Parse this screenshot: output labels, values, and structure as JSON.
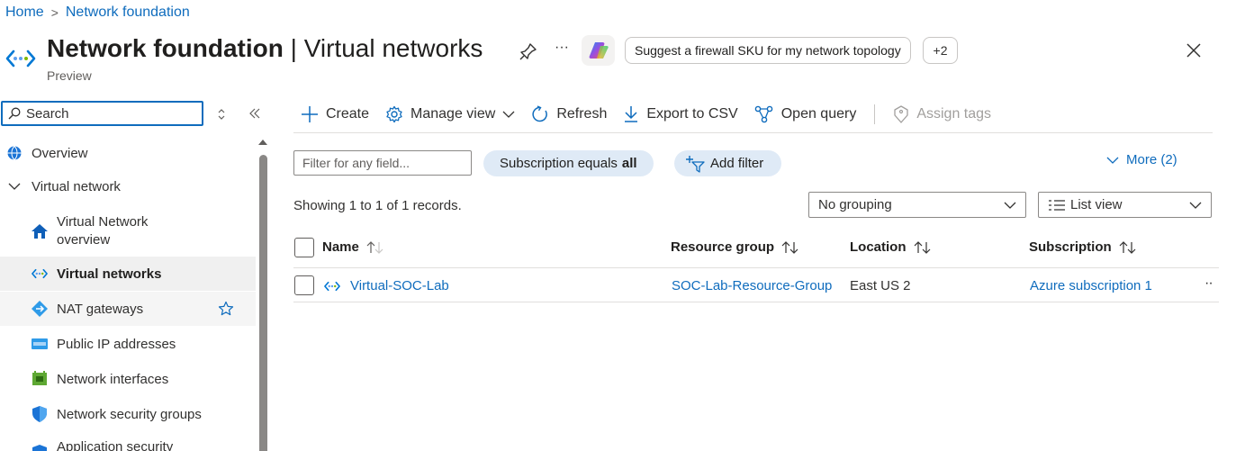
{
  "breadcrumb": {
    "home": "Home",
    "separator": ">",
    "current": "Network foundation"
  },
  "header": {
    "title_bold": "Network foundation",
    "title_separator": "|",
    "title_rest": "Virtual networks",
    "subtitle": "Preview",
    "more": "···",
    "suggestion": "Suggest a firewall SKU for my network topology",
    "more_suggestions": "+2",
    "icons": [
      "virtual-network-icon",
      "pin-icon",
      "more-icon",
      "copilot-icon",
      "close-icon"
    ]
  },
  "sidebar": {
    "search_placeholder": "Search",
    "items": [
      {
        "label": "Overview",
        "icon": "globe-icon",
        "level": 0
      },
      {
        "label": "Virtual network",
        "icon": "chevron-down-icon",
        "level": 0
      },
      {
        "label": "Virtual Network overview",
        "icon": "home-icon",
        "level": 1
      },
      {
        "label": "Virtual networks",
        "icon": "virtual-network-icon",
        "level": 1,
        "selected": true
      },
      {
        "label": "NAT gateways",
        "icon": "nat-gateway-icon",
        "level": 1,
        "starred": true
      },
      {
        "label": "Public IP addresses",
        "icon": "public-ip-icon",
        "level": 1
      },
      {
        "label": "Network interfaces",
        "icon": "network-interface-icon",
        "level": 1
      },
      {
        "label": "Network security groups",
        "icon": "shield-icon",
        "level": 1
      },
      {
        "label": "Application security",
        "icon": "asg-icon",
        "level": 1
      }
    ]
  },
  "toolbar": {
    "create": "Create",
    "manage_view": "Manage view",
    "refresh": "Refresh",
    "export": "Export to CSV",
    "open_query": "Open query",
    "assign_tags": "Assign tags"
  },
  "filters": {
    "placeholder": "Filter for any field...",
    "subscription_prefix": "Subscription equals",
    "subscription_value": "all",
    "add_filter": "Add filter",
    "more": "More (2)"
  },
  "records_text": "Showing 1 to 1 of 1 records.",
  "grouping": {
    "value": "No grouping"
  },
  "view": {
    "value": "List view"
  },
  "table": {
    "columns": [
      "Name",
      "Resource group",
      "Location",
      "Subscription"
    ],
    "rows": [
      {
        "name": "Virtual-SOC-Lab",
        "resource_group": "SOC-Lab-Resource-Group",
        "location": "East US 2",
        "subscription": "Azure subscription 1",
        "more": "··"
      }
    ]
  },
  "colors": {
    "accent": "#0f6cbd",
    "pill_bg": "#dfeaf6",
    "selected_bg": "#f0f0f0"
  }
}
